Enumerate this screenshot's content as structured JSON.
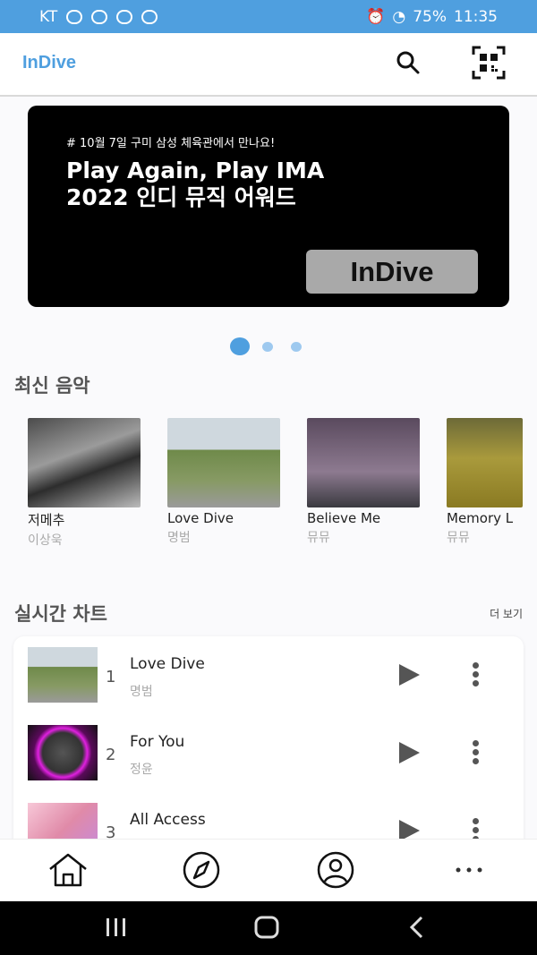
{
  "status": {
    "carrier": "KT",
    "battery": "75%",
    "time": "11:35"
  },
  "app": {
    "logo": "InDive"
  },
  "banner": {
    "tag": "# 10월 7일 구미 삼성 체육관에서 만나요!",
    "title": "Play Again, Play IMA\n2022 인디 뮤직 어워드",
    "badge": "InDive"
  },
  "carousel": {
    "active_index": 0,
    "count": 3
  },
  "latest": {
    "title": "최신 음악",
    "items": [
      {
        "name": "저메추",
        "artist": "이상욱"
      },
      {
        "name": "Love Dive",
        "artist": "명범"
      },
      {
        "name": "Believe Me",
        "artist": "뮤뮤"
      },
      {
        "name": "Memory L",
        "artist": "뮤뮤"
      }
    ]
  },
  "chart": {
    "title": "실시간 차트",
    "more": "더 보기",
    "rows": [
      {
        "rank": "1",
        "song": "Love Dive",
        "artist": "명범"
      },
      {
        "rank": "2",
        "song": "For You",
        "artist": "정윤"
      },
      {
        "rank": "3",
        "song": "All Access",
        "artist": ""
      }
    ]
  },
  "nav": {
    "items": [
      "home-icon",
      "compass-icon",
      "profile-icon",
      "more-horizontal-icon"
    ]
  },
  "colors": {
    "accent": "#4f9fdf",
    "banner_bg": "#000000"
  }
}
